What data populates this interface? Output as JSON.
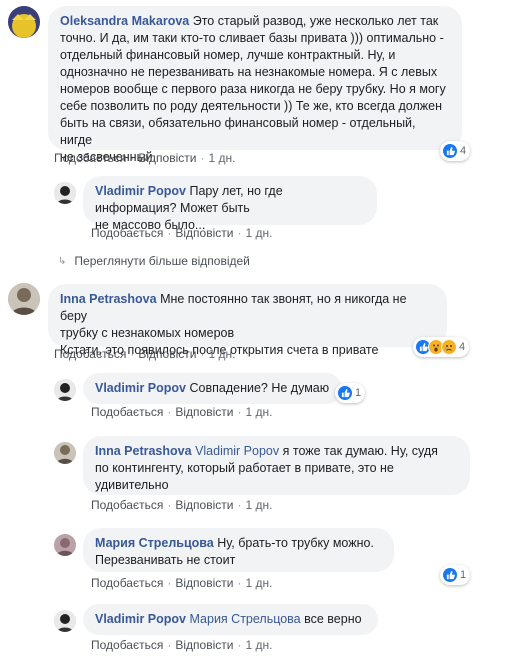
{
  "actions": {
    "like": "Подобається",
    "reply": "Відповісти",
    "sep": "·"
  },
  "comments": [
    {
      "name": "Oleksandra Makarova",
      "lines": [
        "Это старый развод, уже несколько лет так",
        "точно. И да, им таки кто-то сливает базы привата ))) оптимально -",
        "отдельный финансовый номер, лучше контрактный. Ну, и",
        "однозначно не перезванивать на незнакомые номера. Я с левых",
        "номеров вообще с первого раза никогда не беру трубку. Но я могу",
        "себе позволить по роду деятельности )) Те же, кто всегда должен",
        "быть на связи, обязательно финансовый номер - отдельный, нигде",
        "не засвеченный."
      ],
      "time": "1 дн.",
      "reactions": {
        "icons": [
          "like-icon"
        ],
        "count": "4"
      }
    },
    {
      "name": "Vladimir Popov",
      "lines": [
        "Пару лет, но где информация? Может быть",
        "не массово было..."
      ],
      "time": "1 дн."
    },
    {
      "more_replies": "Переглянути більше відповідей"
    },
    {
      "name": "Inna Petrashova",
      "lines": [
        "Мне постоянно так звонят, но я никогда не беру",
        "трубку с незнакомых номеров",
        "Кстати, это появилось после открытия счета в привате"
      ],
      "time": "1 дн.",
      "reactions": {
        "icons": [
          "like-icon",
          "wow-icon",
          "sad-icon"
        ],
        "count": "4"
      }
    },
    {
      "name": "Vladimir Popov",
      "lines": [
        "Совпадение? Не думаю"
      ],
      "time": "1 дн.",
      "reactions": {
        "icons": [
          "like-icon"
        ],
        "count": "1"
      }
    },
    {
      "name": "Inna Petrashova",
      "mention": "Vladimir Popov",
      "lines": [
        "я тоже так думаю. Ну, судя",
        "по контингенту, который работает в привате, это не",
        "удивительно"
      ],
      "time": "1 дн."
    },
    {
      "name": "Мария Стрельцова",
      "lines": [
        "Ну, брать-то трубку можно.",
        "Перезванивать не стоит"
      ],
      "time": "1 дн.",
      "reactions": {
        "icons": [
          "like-icon"
        ],
        "count": "1"
      }
    },
    {
      "name": "Vladimir Popov",
      "mention": "Мария Стрельцова",
      "lines": [
        "все верно"
      ],
      "time": "1 дн."
    }
  ],
  "colors": {
    "link": "#385898",
    "bubble": "#f2f3f5",
    "like": "#1877f2"
  }
}
